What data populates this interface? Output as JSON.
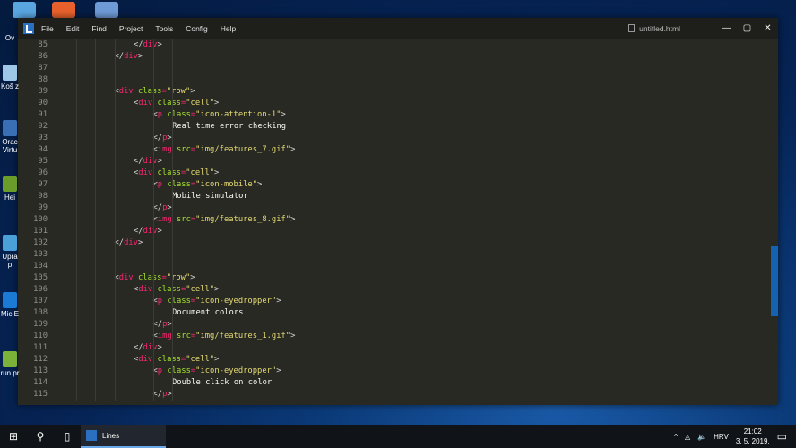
{
  "desktop": {
    "icons": [
      {
        "label": "Ov",
        "color": "#5aa6e0"
      },
      {
        "label": "Koš z",
        "color": "#9fc7e8"
      },
      {
        "label": "Orac Virtu",
        "color": "#3a6fb5"
      },
      {
        "label": "Hei",
        "color": "#6a9c2a"
      },
      {
        "label": "Upra p",
        "color": "#4aa0d8"
      },
      {
        "label": "Mic E",
        "color": "#1a7ad4"
      },
      {
        "label": "run pr",
        "color": "#7ab23a"
      }
    ]
  },
  "window": {
    "menu": [
      "File",
      "Edit",
      "Find",
      "Project",
      "Tools",
      "Config",
      "Help"
    ],
    "filename": "untitled.html",
    "controls": {
      "minimize": "—",
      "maximize": "▢",
      "close": "✕"
    }
  },
  "code": [
    {
      "n": "85",
      "i": 4,
      "t": [
        [
          "p",
          "</"
        ],
        [
          "tag",
          "div"
        ],
        [
          "p",
          ">"
        ]
      ]
    },
    {
      "n": "86",
      "i": 3,
      "t": [
        [
          "p",
          "</"
        ],
        [
          "tag",
          "div"
        ],
        [
          "p",
          ">"
        ]
      ]
    },
    {
      "n": "87",
      "i": 0,
      "t": []
    },
    {
      "n": "88",
      "i": 0,
      "t": []
    },
    {
      "n": "89",
      "i": 3,
      "t": [
        [
          "p",
          "<"
        ],
        [
          "tag",
          "div"
        ],
        [
          "p",
          " "
        ],
        [
          "attr",
          "class"
        ],
        [
          "eq",
          "="
        ],
        [
          "str",
          "\"row\""
        ],
        [
          "p",
          ">"
        ]
      ]
    },
    {
      "n": "90",
      "i": 4,
      "t": [
        [
          "p",
          "<"
        ],
        [
          "tag",
          "div"
        ],
        [
          "p",
          " "
        ],
        [
          "attr",
          "class"
        ],
        [
          "eq",
          "="
        ],
        [
          "str",
          "\"cell\""
        ],
        [
          "p",
          ">"
        ]
      ]
    },
    {
      "n": "91",
      "i": 5,
      "t": [
        [
          "p",
          "<"
        ],
        [
          "tag",
          "p"
        ],
        [
          "p",
          " "
        ],
        [
          "attr",
          "class"
        ],
        [
          "eq",
          "="
        ],
        [
          "str",
          "\"icon-attention-1\""
        ],
        [
          "p",
          ">"
        ]
      ]
    },
    {
      "n": "92",
      "i": 6,
      "t": [
        [
          "text",
          "Real time error checking"
        ]
      ]
    },
    {
      "n": "93",
      "i": 5,
      "t": [
        [
          "p",
          "</"
        ],
        [
          "tag",
          "p"
        ],
        [
          "p",
          ">"
        ]
      ]
    },
    {
      "n": "94",
      "i": 5,
      "t": [
        [
          "p",
          "<"
        ],
        [
          "tag",
          "img"
        ],
        [
          "p",
          " "
        ],
        [
          "attr",
          "src"
        ],
        [
          "eq",
          "="
        ],
        [
          "str",
          "\"img/features_7.gif\""
        ],
        [
          "p",
          ">"
        ]
      ]
    },
    {
      "n": "95",
      "i": 4,
      "t": [
        [
          "p",
          "</"
        ],
        [
          "tag",
          "div"
        ],
        [
          "p",
          ">"
        ]
      ]
    },
    {
      "n": "96",
      "i": 4,
      "t": [
        [
          "p",
          "<"
        ],
        [
          "tag",
          "div"
        ],
        [
          "p",
          " "
        ],
        [
          "attr",
          "class"
        ],
        [
          "eq",
          "="
        ],
        [
          "str",
          "\"cell\""
        ],
        [
          "p",
          ">"
        ]
      ]
    },
    {
      "n": "97",
      "i": 5,
      "t": [
        [
          "p",
          "<"
        ],
        [
          "tag",
          "p"
        ],
        [
          "p",
          " "
        ],
        [
          "attr",
          "class"
        ],
        [
          "eq",
          "="
        ],
        [
          "str",
          "\"icon-mobile\""
        ],
        [
          "p",
          ">"
        ]
      ]
    },
    {
      "n": "98",
      "i": 6,
      "t": [
        [
          "text",
          "Mobile simulator"
        ]
      ]
    },
    {
      "n": "99",
      "i": 5,
      "t": [
        [
          "p",
          "</"
        ],
        [
          "tag",
          "p"
        ],
        [
          "p",
          ">"
        ]
      ]
    },
    {
      "n": "100",
      "i": 5,
      "t": [
        [
          "p",
          "<"
        ],
        [
          "tag",
          "img"
        ],
        [
          "p",
          " "
        ],
        [
          "attr",
          "src"
        ],
        [
          "eq",
          "="
        ],
        [
          "str",
          "\"img/features_8.gif\""
        ],
        [
          "p",
          ">"
        ]
      ]
    },
    {
      "n": "101",
      "i": 4,
      "t": [
        [
          "p",
          "</"
        ],
        [
          "tag",
          "div"
        ],
        [
          "p",
          ">"
        ]
      ]
    },
    {
      "n": "102",
      "i": 3,
      "t": [
        [
          "p",
          "</"
        ],
        [
          "tag",
          "div"
        ],
        [
          "p",
          ">"
        ]
      ]
    },
    {
      "n": "103",
      "i": 0,
      "t": []
    },
    {
      "n": "104",
      "i": 0,
      "t": []
    },
    {
      "n": "105",
      "i": 3,
      "t": [
        [
          "p",
          "<"
        ],
        [
          "tag",
          "div"
        ],
        [
          "p",
          " "
        ],
        [
          "attr",
          "class"
        ],
        [
          "eq",
          "="
        ],
        [
          "str",
          "\"row\""
        ],
        [
          "p",
          ">"
        ]
      ]
    },
    {
      "n": "106",
      "i": 4,
      "t": [
        [
          "p",
          "<"
        ],
        [
          "tag",
          "div"
        ],
        [
          "p",
          " "
        ],
        [
          "attr",
          "class"
        ],
        [
          "eq",
          "="
        ],
        [
          "str",
          "\"cell\""
        ],
        [
          "p",
          ">"
        ]
      ]
    },
    {
      "n": "107",
      "i": 5,
      "t": [
        [
          "p",
          "<"
        ],
        [
          "tag",
          "p"
        ],
        [
          "p",
          " "
        ],
        [
          "attr",
          "class"
        ],
        [
          "eq",
          "="
        ],
        [
          "str",
          "\"icon-eyedropper\""
        ],
        [
          "p",
          ">"
        ]
      ]
    },
    {
      "n": "108",
      "i": 6,
      "t": [
        [
          "text",
          "Document colors"
        ]
      ]
    },
    {
      "n": "109",
      "i": 5,
      "t": [
        [
          "p",
          "</"
        ],
        [
          "tag",
          "p"
        ],
        [
          "p",
          ">"
        ]
      ]
    },
    {
      "n": "110",
      "i": 5,
      "t": [
        [
          "p",
          "<"
        ],
        [
          "tag",
          "img"
        ],
        [
          "p",
          " "
        ],
        [
          "attr",
          "src"
        ],
        [
          "eq",
          "="
        ],
        [
          "str",
          "\"img/features_1.gif\""
        ],
        [
          "p",
          ">"
        ]
      ]
    },
    {
      "n": "111",
      "i": 4,
      "t": [
        [
          "p",
          "</"
        ],
        [
          "tag",
          "div"
        ],
        [
          "p",
          ">"
        ]
      ]
    },
    {
      "n": "112",
      "i": 4,
      "t": [
        [
          "p",
          "<"
        ],
        [
          "tag",
          "div"
        ],
        [
          "p",
          " "
        ],
        [
          "attr",
          "class"
        ],
        [
          "eq",
          "="
        ],
        [
          "str",
          "\"cell\""
        ],
        [
          "p",
          ">"
        ]
      ]
    },
    {
      "n": "113",
      "i": 5,
      "t": [
        [
          "p",
          "<"
        ],
        [
          "tag",
          "p"
        ],
        [
          "p",
          " "
        ],
        [
          "attr",
          "class"
        ],
        [
          "eq",
          "="
        ],
        [
          "str",
          "\"icon-eyedropper\""
        ],
        [
          "p",
          ">"
        ]
      ]
    },
    {
      "n": "114",
      "i": 6,
      "t": [
        [
          "text",
          "Double click on color"
        ]
      ]
    },
    {
      "n": "115",
      "i": 5,
      "t": [
        [
          "p",
          "</"
        ],
        [
          "tag",
          "p"
        ],
        [
          "p",
          ">"
        ]
      ]
    }
  ],
  "taskbar": {
    "start": "⊞",
    "search": "⚲",
    "taskview": "▯",
    "app_label": "Lines",
    "tray_up": "^",
    "network": "◬",
    "volume": "🔈",
    "language": "HRV",
    "time": "21:02",
    "date": "3. 5. 2019.",
    "notifications": "▭"
  }
}
